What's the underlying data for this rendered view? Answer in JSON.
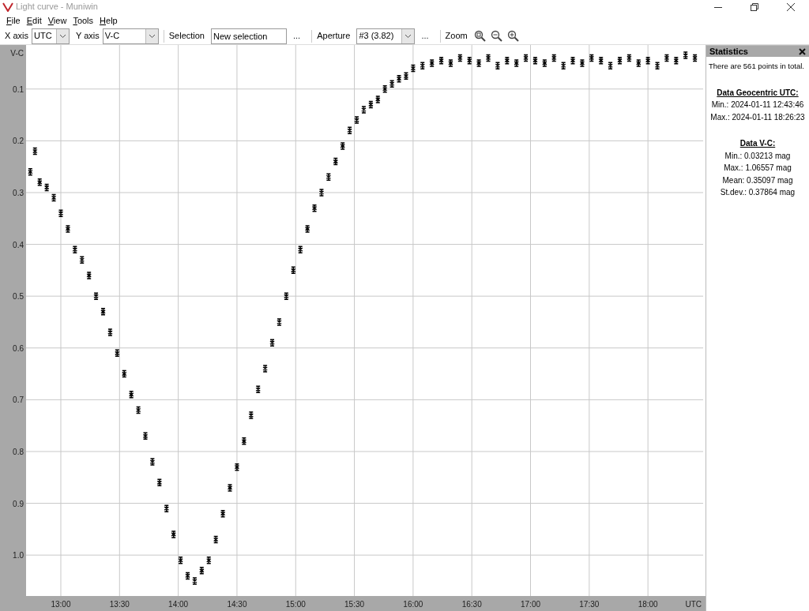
{
  "window": {
    "title": "Light curve - Muniwin"
  },
  "menu": [
    {
      "label": "File"
    },
    {
      "label": "Edit"
    },
    {
      "label": "View"
    },
    {
      "label": "Tools"
    },
    {
      "label": "Help"
    }
  ],
  "toolbar": {
    "x_axis": {
      "label": "X axis",
      "value": "UTC"
    },
    "y_axis": {
      "label": "Y axis",
      "value": "V-C"
    },
    "selection": {
      "label": "Selection",
      "value": "New selection",
      "more": "..."
    },
    "aperture": {
      "label": "Aperture",
      "value": "#3 (3.82)",
      "more": "..."
    },
    "zoom": {
      "label": "Zoom"
    }
  },
  "chart": {
    "chart_data": {
      "type": "scatter",
      "grid": true,
      "xlabel": "UTC",
      "ylabel": "V-C",
      "xlim": [
        12.704,
        18.47
      ],
      "ylim": [
        1.079,
        0.015
      ],
      "xticks": [
        {
          "value": 13,
          "label": "13:00"
        },
        {
          "value": 13.5,
          "label": "13:30"
        },
        {
          "value": 14,
          "label": "14:00"
        },
        {
          "value": 14.5,
          "label": "14:30"
        },
        {
          "value": 15,
          "label": "15:00"
        },
        {
          "value": 15.5,
          "label": "15:30"
        },
        {
          "value": 16,
          "label": "16:00"
        },
        {
          "value": 16.5,
          "label": "16:30"
        },
        {
          "value": 17,
          "label": "17:00"
        },
        {
          "value": 17.5,
          "label": "17:30"
        },
        {
          "value": 18,
          "label": "18:00"
        }
      ],
      "yticks": [
        0.1,
        0.2,
        0.3,
        0.4,
        0.5,
        0.6,
        0.7,
        0.8,
        0.9,
        {
          "value": 1.0,
          "label": "1.0"
        }
      ],
      "x": [
        12.74,
        12.78,
        12.82,
        12.88,
        12.94,
        13.0,
        13.06,
        13.12,
        13.18,
        13.24,
        13.3,
        13.36,
        13.42,
        13.48,
        13.54,
        13.6,
        13.66,
        13.72,
        13.78,
        13.84,
        13.9,
        13.96,
        14.02,
        14.08,
        14.14,
        14.2,
        14.26,
        14.32,
        14.38,
        14.44,
        14.5,
        14.56,
        14.62,
        14.68,
        14.74,
        14.8,
        14.86,
        14.92,
        14.98,
        15.04,
        15.1,
        15.16,
        15.22,
        15.28,
        15.34,
        15.4,
        15.46,
        15.52,
        15.58,
        15.64,
        15.7,
        15.76,
        15.82,
        15.88,
        15.94,
        16.0,
        16.08,
        16.16,
        16.24,
        16.32,
        16.4,
        16.48,
        16.56,
        16.64,
        16.72,
        16.8,
        16.88,
        16.96,
        17.04,
        17.12,
        17.2,
        17.28,
        17.36,
        17.44,
        17.52,
        17.6,
        17.68,
        17.76,
        17.84,
        17.92,
        18.0,
        18.08,
        18.16,
        18.24,
        18.32,
        18.4
      ],
      "series": [
        {
          "color": "#000000",
          "values": [
            0.26,
            0.22,
            0.28,
            0.29,
            0.31,
            0.34,
            0.37,
            0.41,
            0.43,
            0.46,
            0.5,
            0.53,
            0.57,
            0.61,
            0.65,
            0.69,
            0.72,
            0.77,
            0.82,
            0.86,
            0.91,
            0.96,
            1.01,
            1.04,
            1.05,
            1.03,
            1.01,
            0.97,
            0.92,
            0.87,
            0.83,
            0.78,
            0.73,
            0.68,
            0.64,
            0.59,
            0.55,
            0.5,
            0.45,
            0.41,
            0.37,
            0.33,
            0.3,
            0.27,
            0.24,
            0.21,
            0.18,
            0.16,
            0.14,
            0.13,
            0.12,
            0.1,
            0.09,
            0.08,
            0.075,
            0.06,
            0.055,
            0.05,
            0.045,
            0.05,
            0.04,
            0.045,
            0.05,
            0.04,
            0.055,
            0.045,
            0.05,
            0.04,
            0.045,
            0.05,
            0.04,
            0.055,
            0.045,
            0.05,
            0.04,
            0.045,
            0.055,
            0.045,
            0.04,
            0.05,
            0.045,
            0.055,
            0.04,
            0.045,
            0.035,
            0.04
          ]
        }
      ]
    }
  },
  "statistics": {
    "title": "Statistics",
    "summary": "There are 561 points in total.",
    "sections": [
      {
        "heading": "Data Geocentric UTC:",
        "lines": [
          "Min.: 2024-01-11 12:43:46",
          "Max.: 2024-01-11 18:26:23"
        ]
      },
      {
        "heading": "Data V-C:",
        "lines": [
          "Min.: 0.03213 mag",
          "Max.: 1.06557 mag",
          "Mean: 0.35097 mag",
          "St.dev.: 0.37864 mag"
        ]
      }
    ]
  }
}
